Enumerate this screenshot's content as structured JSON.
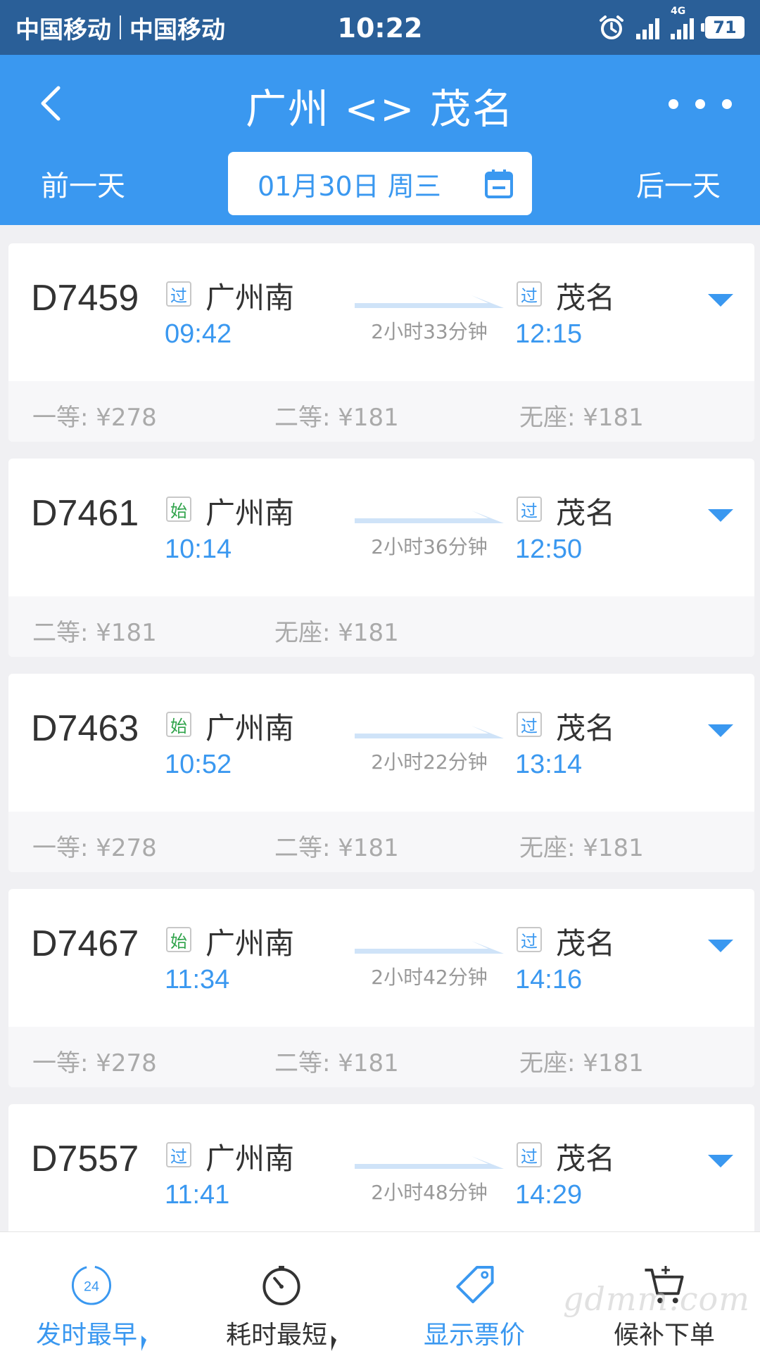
{
  "status_bar": {
    "carrier1": "中国移动",
    "carrier2": "中国移动",
    "time": "10:22",
    "network_label": "4G",
    "battery": "71"
  },
  "header": {
    "title": "广州 <> 茂名",
    "prev_day": "前一天",
    "next_day": "后一天",
    "date": "01月30日 周三"
  },
  "colors": {
    "primary": "#3a98f0",
    "status_bar": "#2a5f98",
    "start_tag": "#2fa34a"
  },
  "trains": [
    {
      "number": "D7459",
      "dep_tag": "过",
      "dep_tag_type": "pass",
      "dep_station": "广州南",
      "dep_time": "09:42",
      "duration": "2小时33分钟",
      "arr_tag": "过",
      "arr_tag_type": "pass",
      "arr_station": "茂名",
      "arr_time": "12:15",
      "prices": [
        "一等: ¥278",
        "二等: ¥181",
        "无座: ¥181"
      ]
    },
    {
      "number": "D7461",
      "dep_tag": "始",
      "dep_tag_type": "start",
      "dep_station": "广州南",
      "dep_time": "10:14",
      "duration": "2小时36分钟",
      "arr_tag": "过",
      "arr_tag_type": "pass",
      "arr_station": "茂名",
      "arr_time": "12:50",
      "prices": [
        "二等: ¥181",
        "无座: ¥181"
      ]
    },
    {
      "number": "D7463",
      "dep_tag": "始",
      "dep_tag_type": "start",
      "dep_station": "广州南",
      "dep_time": "10:52",
      "duration": "2小时22分钟",
      "arr_tag": "过",
      "arr_tag_type": "pass",
      "arr_station": "茂名",
      "arr_time": "13:14",
      "prices": [
        "一等: ¥278",
        "二等: ¥181",
        "无座: ¥181"
      ]
    },
    {
      "number": "D7467",
      "dep_tag": "始",
      "dep_tag_type": "start",
      "dep_station": "广州南",
      "dep_time": "11:34",
      "duration": "2小时42分钟",
      "arr_tag": "过",
      "arr_tag_type": "pass",
      "arr_station": "茂名",
      "arr_time": "14:16",
      "prices": [
        "一等: ¥278",
        "二等: ¥181",
        "无座: ¥181"
      ]
    },
    {
      "number": "D7557",
      "dep_tag": "过",
      "dep_tag_type": "pass",
      "dep_station": "广州南",
      "dep_time": "11:41",
      "duration": "2小时48分钟",
      "arr_tag": "过",
      "arr_tag_type": "pass",
      "arr_station": "茂名",
      "arr_time": "14:29",
      "prices": []
    }
  ],
  "bottom_bar": {
    "items": [
      {
        "label": "发时最早",
        "icon": "clock-24-icon",
        "badge": "24"
      },
      {
        "label": "耗时最短",
        "icon": "stopwatch-icon"
      },
      {
        "label": "显示票价",
        "icon": "price-tag-icon"
      },
      {
        "label": "候补下单",
        "icon": "cart-add-icon"
      }
    ]
  },
  "watermark": "gdmm.com"
}
